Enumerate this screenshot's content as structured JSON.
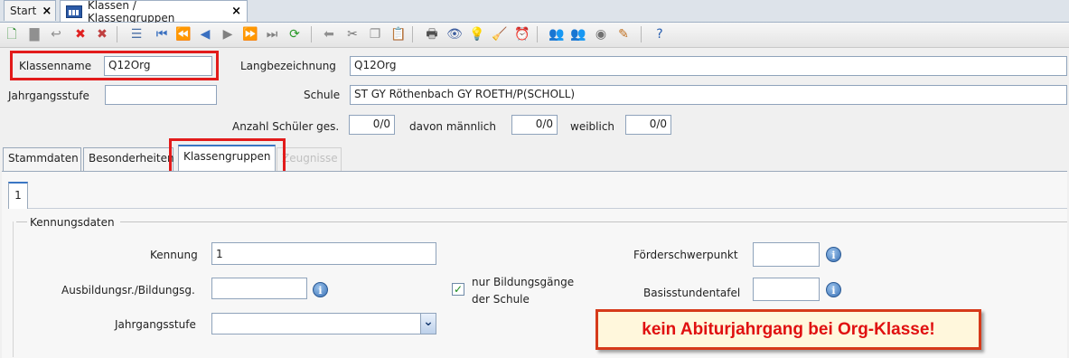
{
  "tabs": [
    {
      "label": "Start",
      "close": "×"
    },
    {
      "label": "Klassen / Klassengruppen",
      "close": "×"
    }
  ],
  "toolbar": {
    "icons": [
      {
        "name": "new-icon",
        "glyph": "🗋",
        "color": "#2a8a2a"
      },
      {
        "name": "save-icon",
        "glyph": "▇",
        "color": "#909090"
      },
      {
        "name": "undo-icon",
        "glyph": "↩",
        "color": "#909090"
      },
      {
        "name": "delete-icon",
        "glyph": "✖",
        "color": "#e02020"
      },
      {
        "name": "delete-record-icon",
        "glyph": "✖",
        "color": "#c04040"
      },
      {
        "name": "list-icon",
        "glyph": "☰",
        "color": "#4a6fa5"
      },
      {
        "name": "first-record-icon",
        "glyph": "⏮",
        "color": "#3a70c0"
      },
      {
        "name": "rewind-icon",
        "glyph": "⏪",
        "color": "#3a70c0"
      },
      {
        "name": "previous-record-icon",
        "glyph": "◀",
        "color": "#3a70c0"
      },
      {
        "name": "next-record-icon",
        "glyph": "▶",
        "color": "#808080"
      },
      {
        "name": "fast-forward-icon",
        "glyph": "⏩",
        "color": "#808080"
      },
      {
        "name": "last-record-icon",
        "glyph": "⏭",
        "color": "#808080"
      },
      {
        "name": "refresh-icon",
        "glyph": "⟳",
        "color": "#2a9a2a"
      },
      {
        "name": "back-icon",
        "glyph": "⬅",
        "color": "#909090"
      },
      {
        "name": "cut-icon",
        "glyph": "✂",
        "color": "#707070"
      },
      {
        "name": "copy-icon",
        "glyph": "❐",
        "color": "#909090"
      },
      {
        "name": "paste-icon",
        "glyph": "📋",
        "color": "#909090"
      },
      {
        "name": "print-icon",
        "glyph": "🖶",
        "color": "#505050"
      },
      {
        "name": "preview-icon",
        "glyph": "👁",
        "color": "#4060a0"
      },
      {
        "name": "hint-icon",
        "glyph": "💡",
        "color": "#e0b020"
      },
      {
        "name": "clean-icon",
        "glyph": "🧹",
        "color": "#c08020"
      },
      {
        "name": "clock-icon",
        "glyph": "⏰",
        "color": "#2070c0"
      },
      {
        "name": "users-icon",
        "glyph": "👥",
        "color": "#2a8a2a"
      },
      {
        "name": "user-group-icon",
        "glyph": "👥",
        "color": "#808080"
      },
      {
        "name": "unit-icon",
        "glyph": "◉",
        "color": "#707070"
      },
      {
        "name": "edit-note-icon",
        "glyph": "✎",
        "color": "#c07020"
      },
      {
        "name": "help-icon",
        "glyph": "?",
        "color": "#2a60b0"
      }
    ]
  },
  "header": {
    "klassenname_label": "Klassenname",
    "klassenname_value": "Q12Org",
    "langbezeichnung_label": "Langbezeichnung",
    "langbezeichnung_value": "Q12Org",
    "jahrgangsstufe_label": "Jahrgangsstufe",
    "jahrgangsstufe_value": "",
    "schule_label": "Schule",
    "schule_value": "ST GY Röthenbach GY ROETH/P(SCHOLL)",
    "anzahl_label": "Anzahl Schüler ges.",
    "anzahl_value": "0/0",
    "maennlich_label": "davon männlich",
    "maennlich_value": "0/0",
    "weiblich_label": "weiblich",
    "weiblich_value": "0/0"
  },
  "page_tabs": [
    {
      "label": "Stammdaten"
    },
    {
      "label": "Besonderheiten"
    },
    {
      "label": "Klassengruppen"
    },
    {
      "label": "Zeugnisse"
    }
  ],
  "subtab": {
    "label": "1"
  },
  "kennungsdaten": {
    "section_title": "Kennungsdaten",
    "kennung_label": "Kennung",
    "kennung_value": "1",
    "ausbildung_label": "Ausbildungsr./Bildungsg.",
    "ausbildung_value": "",
    "checkbox_label_line1": "nur Bildungsgänge",
    "checkbox_label_line2": "der Schule",
    "checkbox_checked": true,
    "checkbox_mark": "✓",
    "jahrgangsstufe_label": "Jahrgangsstufe",
    "jahrgangsstufe_value": "",
    "foerder_label": "Förderschwerpunkt",
    "foerder_value": "",
    "basis_label": "Basisstundentafel",
    "basis_value": "",
    "info_glyph": "i",
    "dropdown_glyph": "⌄"
  },
  "annotation": {
    "text": "kein Abiturjahrgang bei Org-Klasse!"
  },
  "colors": {
    "highlight_red": "#e21b1b",
    "note_text": "#e01010",
    "tab_accent": "#3a76c4"
  }
}
